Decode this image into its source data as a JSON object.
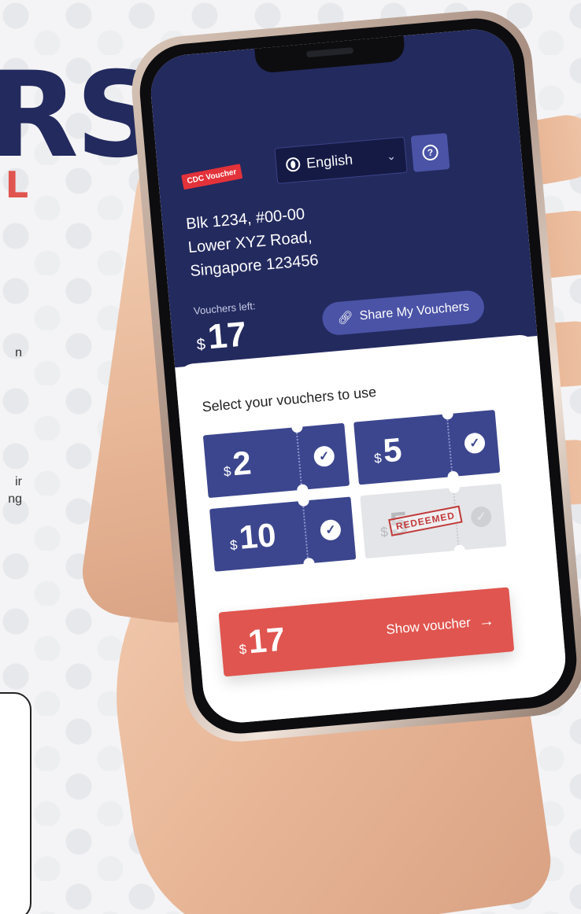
{
  "background": {
    "title_fragment": "RS",
    "subtitle_fragment": "L",
    "side_text": [
      "n",
      "ir",
      "ng"
    ]
  },
  "app": {
    "logo_text": "CDC Voucher",
    "language": {
      "selected": "English"
    },
    "help_glyph": "?",
    "address": {
      "line1": "Blk 1234, #00-00",
      "line2": "Lower XYZ Road,",
      "line3": "Singapore 123456"
    },
    "vouchers_left": {
      "label": "Vouchers left:",
      "currency": "$",
      "amount": "17"
    },
    "share_button_label": "Share My Vouchers",
    "select_title": "Select your vouchers to use",
    "vouchers": [
      {
        "currency": "$",
        "amount": "2",
        "status": "selected"
      },
      {
        "currency": "$",
        "amount": "5",
        "status": "selected"
      },
      {
        "currency": "$",
        "amount": "10",
        "status": "selected"
      },
      {
        "currency": "$",
        "amount": "5",
        "status": "redeemed",
        "stamp": "REDEEMED"
      }
    ],
    "total": {
      "currency": "$",
      "amount": "17",
      "button_label": "Show voucher"
    }
  },
  "colors": {
    "header": "#232a5e",
    "voucher": "#3c468e",
    "accent": "#e0554f"
  }
}
